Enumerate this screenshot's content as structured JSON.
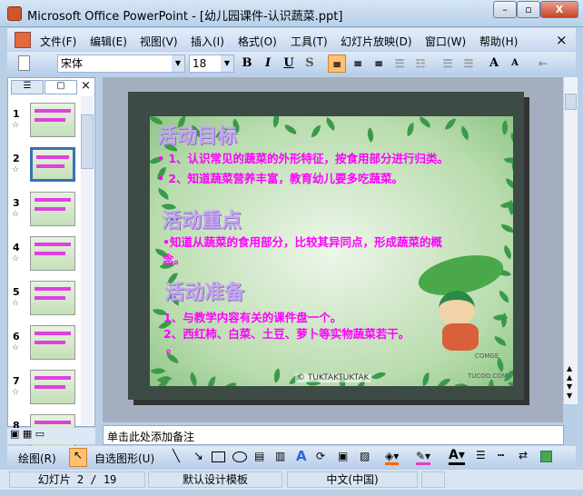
{
  "window": {
    "title": "Microsoft Office PowerPoint - [幼儿园课件-认识蔬菜.ppt]",
    "minimize": "–",
    "restore": "▫",
    "close": "X"
  },
  "menu": [
    "文件(F)",
    "编辑(E)",
    "视图(V)",
    "插入(I)",
    "格式(O)",
    "工具(T)",
    "幻灯片放映(D)",
    "窗口(W)",
    "帮助(H)"
  ],
  "menu_close": "×",
  "format": {
    "font": "宋体",
    "size": "18",
    "bold": "B",
    "italic": "I",
    "underline": "U",
    "shadow": "S",
    "grow": "A",
    "shrink": "A"
  },
  "slides": [
    "1",
    "2",
    "3",
    "4",
    "5",
    "6",
    "7",
    "8"
  ],
  "selected_slide": 2,
  "slide": {
    "heading1": "活动目标",
    "items1": [
      "• 1、认识常见的蔬菜的外形特征，按食用部分进行归类。",
      "• 2、知道蔬菜营养丰富，教育幼儿要多吃蔬菜。"
    ],
    "heading2": "活动重点",
    "items2": [
      "•知道从蔬菜的食用部分，比较其异同点，形成蔬菜的概",
      "念。"
    ],
    "heading3": "活动准备",
    "items3": [
      "1、与教学内容有关的课件盘一个。",
      "2、西红柿、白菜、土豆、萝卜等实物蔬菜若干。",
      "。"
    ],
    "credit1": "COMGE",
    "credit2": "TUCOO.COM",
    "credit3": "© TUKTAKTUKTAK"
  },
  "notes": "单击此处添加备注",
  "drawing": {
    "draw": "绘图(R)",
    "autoshapes": "自选图形(U)"
  },
  "status": {
    "slide": "幻灯片 2 / 19",
    "template": "默认设计模板",
    "language": "中文(中国)"
  },
  "colors": {
    "accent": "#ff00ff",
    "selected": "#3b6fb3"
  }
}
